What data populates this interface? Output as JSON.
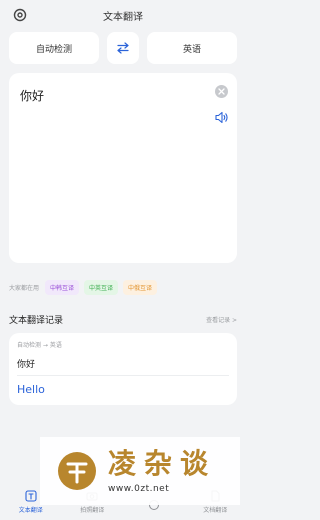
{
  "header": {
    "title": "文本翻译",
    "settings_icon": "gear-icon"
  },
  "languages": {
    "source": "自动检测",
    "swap_icon": "swap-arrows-icon",
    "target": "英语"
  },
  "input": {
    "text": "你好",
    "clear_icon": "clear-icon",
    "speaker_icon": "speaker-icon"
  },
  "phrases": {
    "label": "大家都在用",
    "chips": [
      {
        "label": "中韩互译"
      },
      {
        "label": "中英互译"
      },
      {
        "label": "中俄互译"
      }
    ]
  },
  "history": {
    "title": "文本翻译记录",
    "more": "查看记录 >",
    "entry": {
      "langs": "自动检测 → 英语",
      "source": "你好",
      "target": "Hello"
    }
  },
  "watermark": {
    "chars": "凌杂谈",
    "url": "www.0zt.net"
  },
  "tabbar": [
    {
      "label": "文本翻译",
      "active": true
    },
    {
      "label": "拍照翻译",
      "active": false
    },
    {
      "label": "",
      "active": false
    },
    {
      "label": "文档翻译",
      "active": false
    }
  ],
  "colors": {
    "accent": "#2b63d9",
    "background": "#f2f3f5",
    "watermark_gold": "#b8862d"
  }
}
